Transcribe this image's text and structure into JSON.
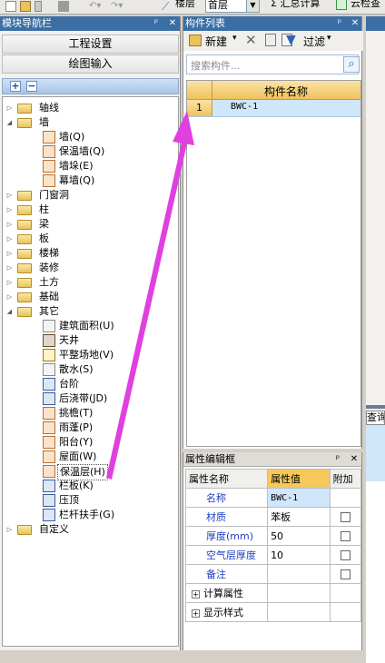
{
  "toolbar": {
    "floor_label": "楼层",
    "floor_value": "首层",
    "summary_label": "Σ 汇总计算",
    "check_label": "云检查"
  },
  "nav": {
    "title": "模块导航栏",
    "btn_engineering": "工程设置",
    "btn_drawing": "绘图输入",
    "tree": [
      {
        "label": "轴线"
      },
      {
        "label": "墙"
      },
      {
        "label": "墙(Q)"
      },
      {
        "label": "保温墙(Q)"
      },
      {
        "label": "墙垛(E)"
      },
      {
        "label": "幕墙(Q)"
      },
      {
        "label": "门窗洞"
      },
      {
        "label": "柱"
      },
      {
        "label": "梁"
      },
      {
        "label": "板"
      },
      {
        "label": "楼梯"
      },
      {
        "label": "装修"
      },
      {
        "label": "土方"
      },
      {
        "label": "基础"
      },
      {
        "label": "其它"
      },
      {
        "label": "建筑面积(U)"
      },
      {
        "label": "天井"
      },
      {
        "label": "平整场地(V)"
      },
      {
        "label": "散水(S)"
      },
      {
        "label": "台阶"
      },
      {
        "label": "后浇带(JD)"
      },
      {
        "label": "挑檐(T)"
      },
      {
        "label": "雨蓬(P)"
      },
      {
        "label": "阳台(Y)"
      },
      {
        "label": "屋面(W)"
      },
      {
        "label": "保温层(H)"
      },
      {
        "label": "栏板(K)"
      },
      {
        "label": "压顶"
      },
      {
        "label": "栏杆扶手(G)"
      },
      {
        "label": "自定义"
      }
    ]
  },
  "component_list": {
    "title": "构件列表",
    "new_label": "新建",
    "filter_label": "过滤",
    "search_placeholder": "搜索构件...",
    "column_header": "构件名称",
    "rows": [
      {
        "index": "1",
        "name": "BWC-1"
      }
    ]
  },
  "properties": {
    "title": "属性编辑框",
    "headers": {
      "name": "属性名称",
      "value": "属性值",
      "extra": "附加"
    },
    "rows": [
      {
        "name": "名称",
        "value": "BWC-1"
      },
      {
        "name": "材质",
        "value": "苯板"
      },
      {
        "name": "厚度(mm)",
        "value": "50"
      },
      {
        "name": "空气层厚度",
        "value": "10"
      },
      {
        "name": "备注",
        "value": ""
      }
    ],
    "group_calc": "计算属性",
    "group_display": "显示样式"
  },
  "right_panel": {
    "query_label": "查询"
  },
  "colors": {
    "arrow": "#e040e0",
    "titlebar": "#3a6ea5",
    "header": "#f0c25a"
  }
}
